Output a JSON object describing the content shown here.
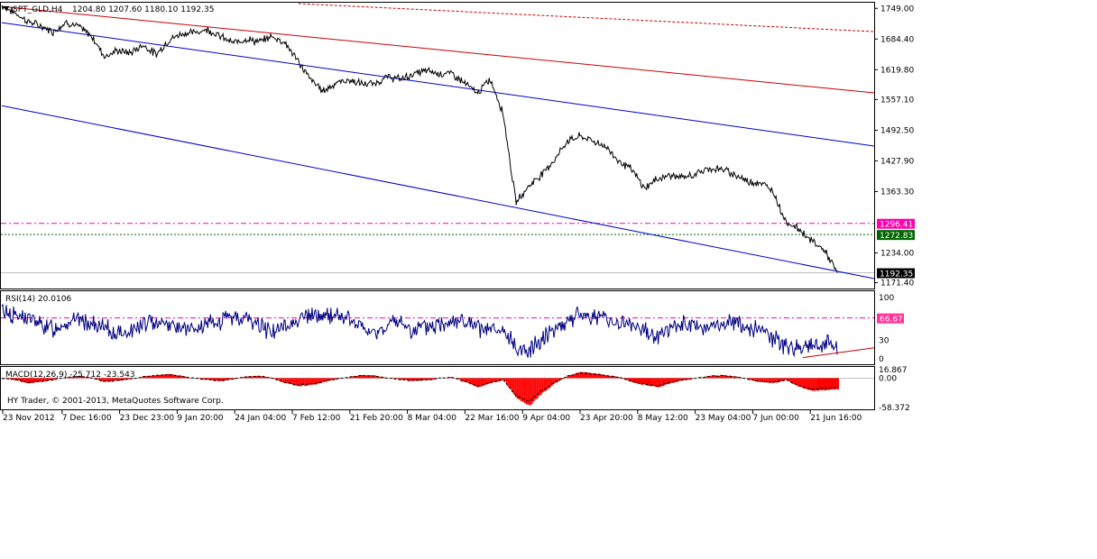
{
  "header": {
    "symbol_label": "SPT_GLD,H4",
    "ohlc_label": "1204.80 1207.60 1180.10 1192.35"
  },
  "panes": {
    "rsi_label": "RSI(14) 20.0106",
    "macd_label": "MACD(12,26,9) -25.712 -23.543",
    "copyright": "HY Trader, © 2001-2013, MetaQuotes Software Corp."
  },
  "colors": {
    "price_line": "#000000",
    "channel_blue": "#0000cc",
    "trend_red": "#cc0000",
    "level_magenta": "#ff00aa",
    "level_green": "#006600",
    "rsi_line": "#000080",
    "macd_hist": "#ff0000",
    "rsi_badge": "#ff3399",
    "current_badge": "#000000"
  },
  "chart_data": [
    {
      "type": "line",
      "pane": "price",
      "y_ticks": [
        "1749.00",
        "1684.40",
        "1619.80",
        "1557.10",
        "1492.50",
        "1427.90",
        "1363.30",
        "1234.00",
        "1171.40"
      ],
      "ylim": [
        1163,
        1759
      ],
      "x_tick_labels": [
        "23 Nov 2012",
        "7 Dec 16:00",
        "23 Dec 23:00",
        "9 Jan 20:00",
        "24 Jan 04:00",
        "7 Feb 12:00",
        "21 Feb 20:00",
        "8 Mar 04:00",
        "22 Mar 16:00",
        "9 Apr 04:00",
        "23 Apr 20:00",
        "8 May 12:00",
        "23 May 04:00",
        "7 Jun 00:00",
        "21 Jun 16:00"
      ],
      "price_anchors": [
        1755,
        1740,
        1722,
        1712,
        1700,
        1720,
        1710,
        1690,
        1648,
        1660,
        1655,
        1672,
        1652,
        1682,
        1696,
        1698,
        1705,
        1690,
        1676,
        1685,
        1678,
        1690,
        1678,
        1640,
        1600,
        1575,
        1592,
        1598,
        1590,
        1590,
        1605,
        1600,
        1610,
        1618,
        1612,
        1612,
        1592,
        1570,
        1600,
        1530,
        1340,
        1375,
        1400,
        1430,
        1470,
        1480,
        1470,
        1458,
        1428,
        1410,
        1370,
        1390,
        1398,
        1392,
        1400,
        1412,
        1410,
        1400,
        1385,
        1382,
        1365,
        1300,
        1285,
        1260,
        1240,
        1192.35
      ],
      "levels": [
        {
          "label": "1296.41",
          "value": 1296.41,
          "style": "dash-dot",
          "color": "level_magenta"
        },
        {
          "label": "1272.83",
          "value": 1272.83,
          "style": "dotted",
          "color": "level_green"
        },
        {
          "label": "1192.35",
          "value": 1192.35,
          "style": "solid",
          "color": "current_badge"
        }
      ],
      "trend_lines": [
        {
          "name": "channel-upper",
          "from": [
            0,
            1719
          ],
          "to": [
            1,
            1459
          ]
        },
        {
          "name": "channel-lower",
          "from": [
            0,
            1544
          ],
          "to": [
            1,
            1180
          ]
        },
        {
          "name": "red-main",
          "from": [
            0,
            1753
          ],
          "to": [
            1,
            1571
          ]
        },
        {
          "name": "red-dashed",
          "from": [
            0.34,
            1759
          ],
          "to": [
            1,
            1700
          ]
        }
      ]
    },
    {
      "type": "line",
      "pane": "rsi",
      "y_ticks": [
        "100",
        "66.67",
        "30",
        "0"
      ],
      "ylim": [
        0,
        100
      ],
      "level": 66.67,
      "rsi_anchors": [
        80,
        70,
        68,
        55,
        50,
        60,
        65,
        55,
        50,
        40,
        45,
        55,
        62,
        58,
        50,
        45,
        55,
        60,
        70,
        65,
        55,
        45,
        50,
        65,
        70,
        68,
        72,
        65,
        50,
        40,
        55,
        60,
        45,
        50,
        55,
        65,
        60,
        50,
        45,
        42,
        20,
        10,
        35,
        50,
        62,
        72,
        70,
        65,
        60,
        55,
        45,
        38,
        50,
        55,
        52,
        50,
        55,
        60,
        52,
        45,
        35,
        20,
        18,
        22,
        28,
        20
      ],
      "trend_line": {
        "from": [
          0.918,
          2
        ],
        "to": [
          1,
          18
        ]
      }
    },
    {
      "type": "bar",
      "pane": "macd",
      "y_ticks": [
        "16.867",
        "0.00",
        "-58.372"
      ],
      "ylim": [
        -58.372,
        16.867
      ],
      "macd_anchors": [
        0,
        -4,
        -10,
        -8,
        -3,
        2,
        4,
        0,
        -8,
        -5,
        -2,
        3,
        6,
        8,
        4,
        0,
        -4,
        -6,
        -2,
        3,
        5,
        0,
        -10,
        -16,
        -14,
        -8,
        -2,
        2,
        6,
        5,
        0,
        -3,
        -6,
        -4,
        0,
        2,
        -8,
        -18,
        -10,
        -4,
        -40,
        -55,
        -30,
        -10,
        5,
        12,
        10,
        6,
        2,
        -8,
        -14,
        -18,
        -10,
        -4,
        0,
        4,
        6,
        4,
        -2,
        -8,
        -10,
        -4,
        -18,
        -25,
        -24,
        -22
      ]
    }
  ]
}
